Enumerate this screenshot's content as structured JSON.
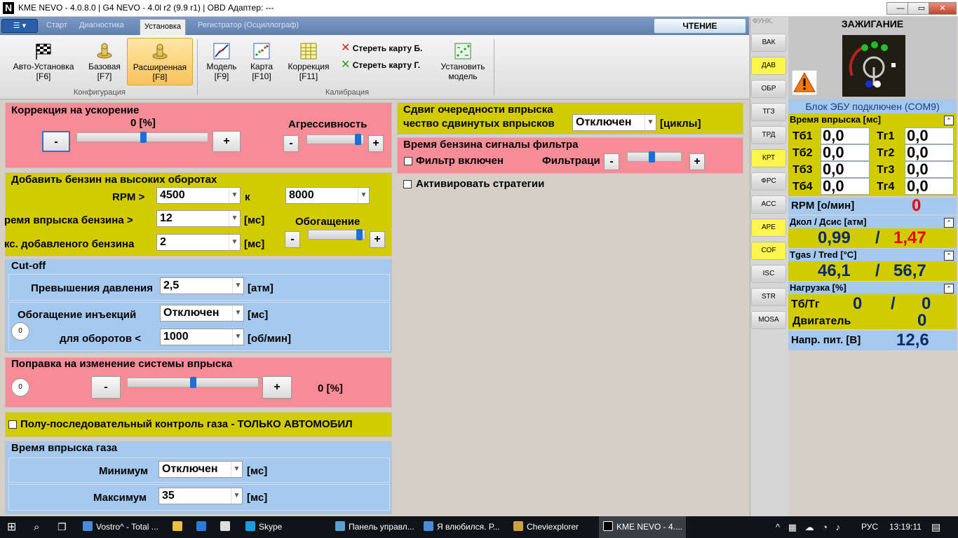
{
  "title": "KME NEVO - 4.0.8.0   |   G4 NEVO - 4.0l r2 (9.9 r1)   |   OBD Адаптер: ---",
  "window_controls": [
    "—",
    "▭",
    "✕"
  ],
  "tabs": [
    "Старт",
    "Диагностика",
    "Установка",
    "Регистратор (Осциллограф)"
  ],
  "read_button": "ЧТЕНИЕ",
  "ribbon": {
    "buttons": [
      {
        "label": "Авто-Установка",
        "key": "[F6]"
      },
      {
        "label": "Базовая",
        "key": "[F7]"
      },
      {
        "label": "Расширенная",
        "key": "[F8]"
      },
      {
        "label": "Модель",
        "key": "[F9]"
      },
      {
        "label": "Карта",
        "key": "[F10]"
      },
      {
        "label": "Коррекция",
        "key": "[F11]"
      }
    ],
    "erase_b": "Стереть карту Б.",
    "erase_g": "Стереть карту Г.",
    "set_model_1": "Установить",
    "set_model_2": "модель",
    "group_config": "Конфигурация",
    "group_calib": "Калибрация"
  },
  "accel": {
    "title": "Коррекция на ускорение",
    "value": "0  [%]",
    "aggr": "Агрессивность"
  },
  "high_rpm": {
    "title": "Добавить бензин на высоких оборотах",
    "rpm_label": "RPM >",
    "rpm_from": "4500",
    "to_label": "к",
    "rpm_to": "8000",
    "inj_label": "ремя впрыска бензина >",
    "inj_value": "12",
    "unit_ms": "[мс]",
    "max_label": "кс. добавленого бензина",
    "max_value": "2",
    "enrich": "Обогащение"
  },
  "cutoff": {
    "title": "Cut-off",
    "press_label": "Превышения давления",
    "press_value": "2,5",
    "press_unit": "[атм]",
    "enrich_label": "Обогащение инъекций",
    "enrich_value": "Отключен",
    "enrich_unit": "[мс]",
    "rpm_label": "для оборотов <",
    "rpm_value": "1000",
    "rpm_unit": "[об/мин]",
    "circle": "0"
  },
  "inj_sys": {
    "title": "Поправка на изменение системы впрыска",
    "value": "0  [%]",
    "circle": "0"
  },
  "semi_seq": "Полу-последовательный контроль газа - ТОЛЬКО АВТОМОБИЛ",
  "gas_time": {
    "title": "Время впрыска газа",
    "min_label": "Минимум",
    "min_value": "Отключен",
    "max_label": "Максимум",
    "max_value": "35",
    "unit": "[мс]"
  },
  "shift": {
    "title": "Сдвиг очередности впрыска",
    "count_label": "чество сдвинутых впрысков",
    "value": "Отключен",
    "unit": "[циклы]"
  },
  "filter": {
    "title": "Время бензина сигналы фильтра",
    "enabled_label": "Фильтр включен",
    "filtr_label": "Фильтраци"
  },
  "strategies": "Активировать стратегии",
  "side_header": "ФУНК.",
  "side_buttons": [
    "ВАК",
    "ДАВ",
    "ОБР",
    "ТГЗ",
    "ТРД",
    "КРТ",
    "ФРС",
    "АСС",
    "АРЕ",
    "COF",
    "ISC",
    "STR",
    "MOSA"
  ],
  "right": {
    "header": "ЗАЖИГАНИЕ",
    "ecu_status": "Блок ЭБУ подключен (COM9)",
    "inj_title": "Время впрыска [мс]",
    "tb": [
      {
        "n": "Тб1",
        "v": "0,0"
      },
      {
        "n": "Тб2",
        "v": "0,0"
      },
      {
        "n": "Тб3",
        "v": "0,0"
      },
      {
        "n": "Тб4",
        "v": "0,0"
      }
    ],
    "tg": [
      {
        "n": "Тг1",
        "v": "0,0"
      },
      {
        "n": "Тг2",
        "v": "0,0"
      },
      {
        "n": "Тг3",
        "v": "0,0"
      },
      {
        "n": "Тг4",
        "v": "0,0"
      }
    ],
    "rpm_label": "RPM [о/мин]",
    "rpm_value": "0",
    "press_title": "Дкол / Дсис [атм]",
    "p1": "0,99",
    "slash": "/",
    "p2": "1,47",
    "temp_title": "Tgas / Tred [°C]",
    "t1": "46,1",
    "t2": "56,7",
    "load_title": "Нагрузка [%]",
    "tbtg_label": "Тб/Тг",
    "tbtg1": "0",
    "tbtg2": "0",
    "engine_label": "Двигатель",
    "engine_value": "0",
    "volt_label": "Напр. пит. [В]",
    "volt_value": "12,6"
  },
  "taskbar": {
    "items": [
      "Vostro^ - Total ...",
      "",
      "",
      "",
      "Skype",
      "Панель управл...",
      "Я влюбился. Р...",
      "Cheviexplorer",
      "KME NEVO - 4...."
    ],
    "lang": "РУС",
    "time": "13:19:11"
  },
  "colors": {
    "pink": "#f68c96",
    "yellow": "#d2cb00",
    "blue": "#a5c8ef",
    "ribbon_sel": "#f7c35a",
    "red_value": "#e80000",
    "navy_value": "#0a2a6a"
  }
}
